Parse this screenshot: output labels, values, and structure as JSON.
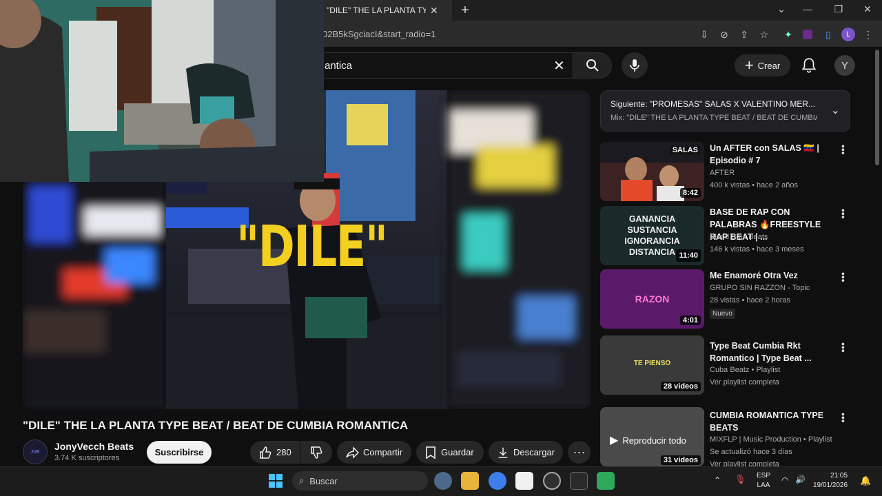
{
  "browser": {
    "tab_title": "\"DILE\" THE LA PLANTA TYPE",
    "url_fragment": "02B5kSgciacI&start_radio=1"
  },
  "header": {
    "search_value": "antica",
    "create_label": "Crear",
    "avatar_letter": "Y"
  },
  "video": {
    "overlay_text": "\"DILE\"",
    "title": "\"DILE\" THE LA PLANTA TYPE BEAT / BEAT DE CUMBIA ROMANTICA"
  },
  "channel": {
    "name": "JonyVecch Beats",
    "subscribers": "3.74 K suscriptores",
    "subscribe_label": "Suscribirse",
    "logo_text": "JVB"
  },
  "actions": {
    "likes": "280",
    "share": "Compartir",
    "save": "Guardar",
    "download": "Descargar"
  },
  "up_next": {
    "line1": "Siguiente: \"PROMESAS\" SALAS X VALENTINO MER...",
    "line2": "Mix: \"DILE\" THE LA PLANTA TYPE BEAT / BEAT DE CUMBIA R..."
  },
  "recommendations": [
    {
      "title": "Un AFTER con SALAS 🇻🇪 | Episodio # 7",
      "channel": "AFTER",
      "meta": "400 k vistas • hace 2 años",
      "duration": "8:42",
      "thumb_text": "SALAS"
    },
    {
      "title": "BASE DE RAP CON PALABRAS 🔥FREESTYLE RAP BEAT | ...",
      "channel": "Blood Soul Beats",
      "meta": "146 k vistas • hace 3 meses",
      "duration": "11:40",
      "thumb_lines": [
        "GANANCIA",
        "SUSTANCIA",
        "IGNORANCIA",
        "DISTANCIA"
      ]
    },
    {
      "title": "Me Enamoré Otra Vez",
      "channel": "GRUPO SIN RAZZON - Topic",
      "meta": "28 vistas • hace 2 horas",
      "duration": "4:01",
      "badge": "Nuevo",
      "thumb_text": "RAZON"
    },
    {
      "title": "Type Beat Cumbia Rkt Romantico | Type Beat ...",
      "channel": "Cuba Beatz • Playlist",
      "meta": "Ver playlist completa",
      "duration": "28 videos",
      "thumb_text": "TE PIENSO"
    },
    {
      "title": "CUMBIA ROMANTICA TYPE BEATS",
      "channel": "MIXFLP | Music Production • Playlist",
      "meta": "Se actualizó hace 3 días",
      "meta2": "Ver playlist completa",
      "duration": "31 videos",
      "hover_label": "Reproducir todo"
    }
  ],
  "taskbar": {
    "search_placeholder": "Buscar",
    "lang1": "ESP",
    "lang2": "LAA",
    "time": "21:05",
    "date": "19/01/2026"
  }
}
